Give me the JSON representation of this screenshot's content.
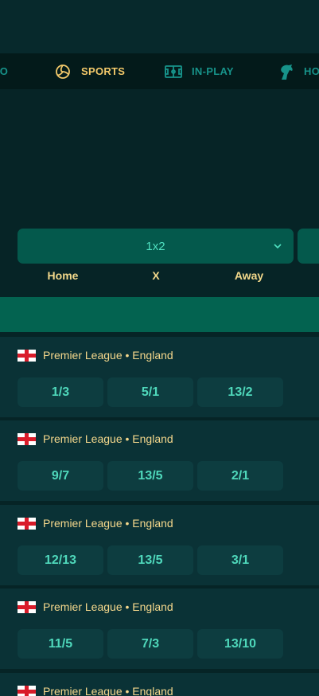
{
  "nav": {
    "items": [
      {
        "label": "NO",
        "icon": "casino-icon"
      },
      {
        "label": "SPORTS",
        "icon": "volleyball-icon"
      },
      {
        "label": "IN-PLAY",
        "icon": "pitch-icon"
      },
      {
        "label": "HO",
        "icon": "horse-icon"
      }
    ]
  },
  "market": {
    "selected": "1x2",
    "columns": [
      "Home",
      "X",
      "Away"
    ]
  },
  "matches": [
    {
      "league": "Premier League • England",
      "odds": [
        "1/3",
        "5/1",
        "13/2"
      ]
    },
    {
      "league": "Premier League • England",
      "odds": [
        "9/7",
        "13/5",
        "2/1"
      ]
    },
    {
      "league": "Premier League • England",
      "odds": [
        "12/13",
        "13/5",
        "3/1"
      ]
    },
    {
      "league": "Premier League • England",
      "odds": [
        "11/5",
        "7/3",
        "13/10"
      ]
    },
    {
      "league": "Premier League • England",
      "odds": []
    }
  ],
  "colors": {
    "background": "#062426",
    "accent_gold": "#f3c96a",
    "accent_teal": "#17938a",
    "odds_text": "#4fd8bb"
  }
}
